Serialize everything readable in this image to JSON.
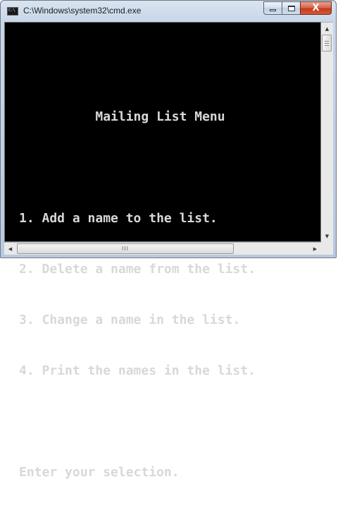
{
  "window": {
    "title": "C:\\Windows\\system32\\cmd.exe",
    "icon": "cmd-icon",
    "icon_text": "C:\\",
    "controls": {
      "minimize_icon": "minimize-icon",
      "maximize_icon": "maximize-icon",
      "close_icon": "close-icon",
      "close_glyph": "X"
    },
    "colors": {
      "console_bg": "#000000",
      "console_text": "#d8d8d8",
      "close_button": "#c7381b"
    }
  },
  "console": {
    "lines": [
      "",
      "          Mailing List Menu",
      "",
      "1. Add a name to the list.",
      "2. Delete a name from the list.",
      "3. Change a name in the list.",
      "4. Print the names in the list.",
      "",
      "Enter your selection."
    ]
  },
  "scrollbars": {
    "vertical": {
      "up_arrow": "▲",
      "down_arrow": "▼"
    },
    "horizontal": {
      "left_arrow": "◀",
      "right_arrow": "▶",
      "thumb_grip": "III"
    }
  }
}
